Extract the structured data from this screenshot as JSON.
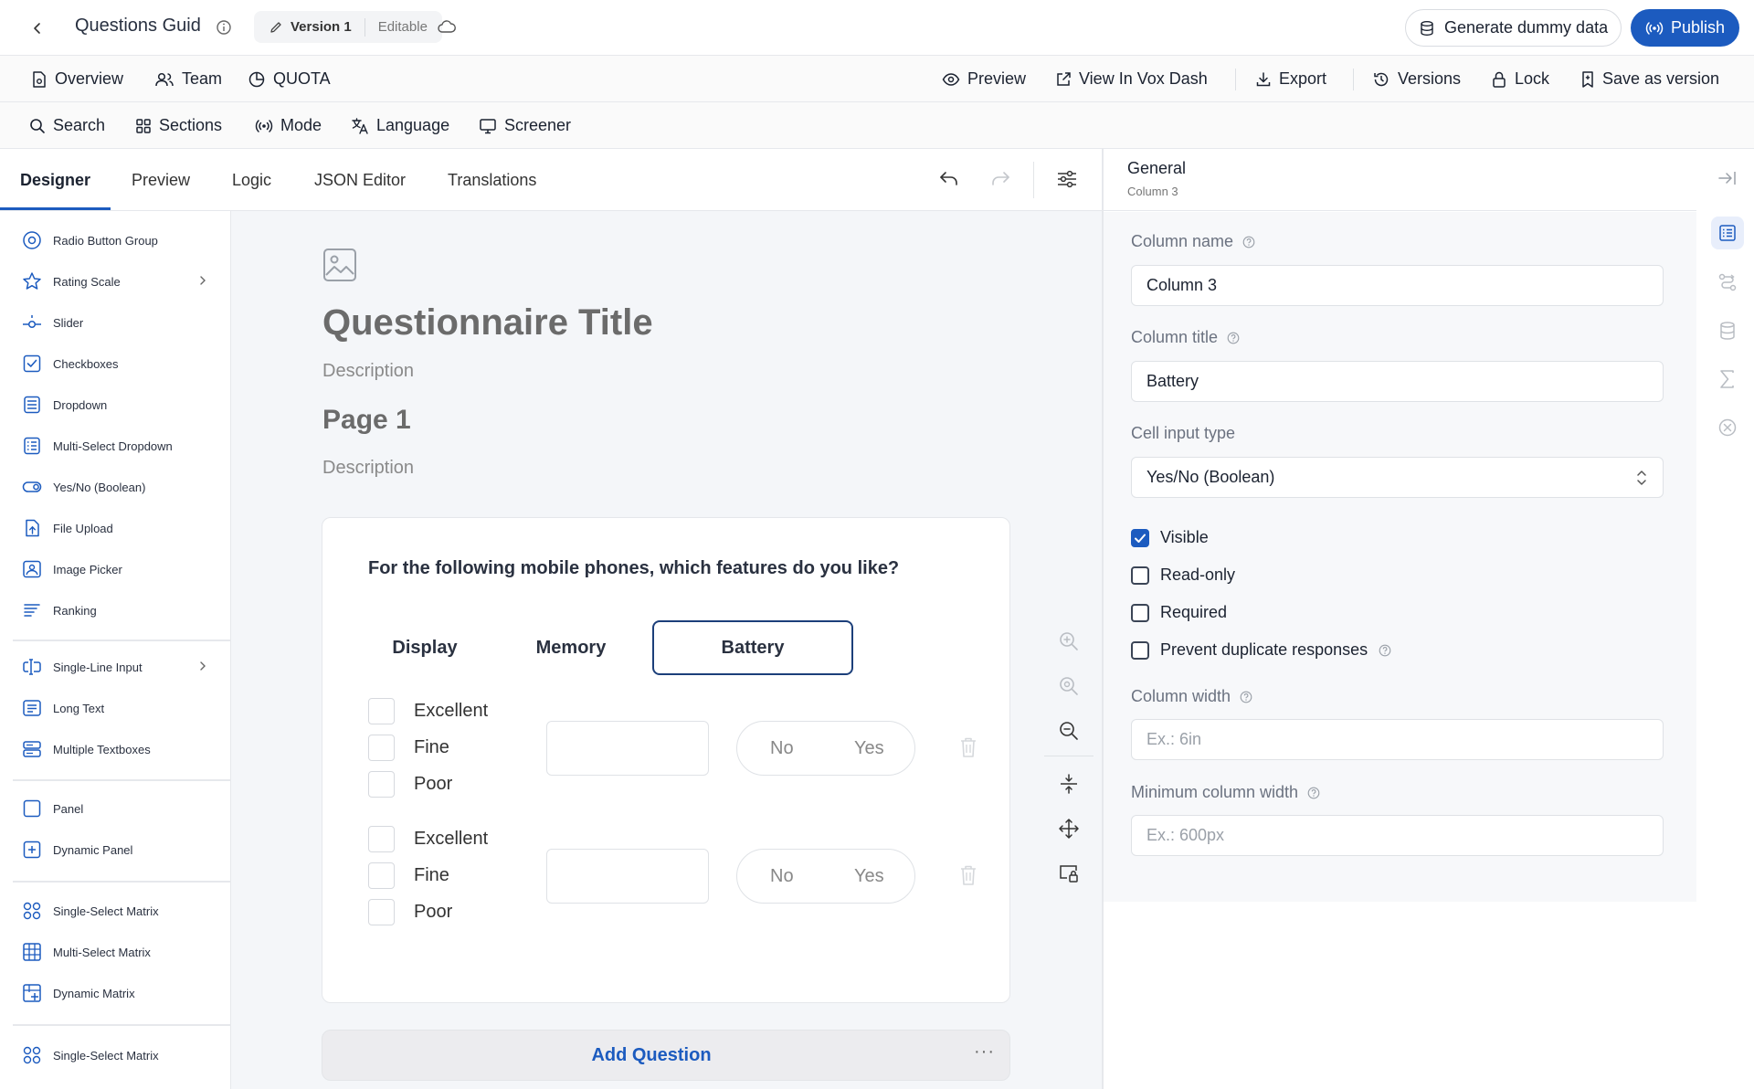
{
  "header": {
    "title": "Questions Guid",
    "version_label": "Version 1",
    "version_state": "Editable",
    "generate_label": "Generate dummy data",
    "publish_label": "Publish"
  },
  "nav1": {
    "overview": "Overview",
    "team": "Team",
    "quota": "QUOTA",
    "preview": "Preview",
    "view_vox": "View In Vox Dash",
    "export": "Export",
    "versions": "Versions",
    "lock": "Lock",
    "save_version": "Save as version"
  },
  "nav2": {
    "search": "Search",
    "sections": "Sections",
    "mode": "Mode",
    "language": "Language",
    "screener": "Screener"
  },
  "tabs": [
    "Designer",
    "Preview",
    "Logic",
    "JSON Editor",
    "Translations"
  ],
  "toolbox": {
    "items": [
      "Radio Button Group",
      "Rating Scale",
      "Slider",
      "Checkboxes",
      "Dropdown",
      "Multi-Select Dropdown",
      "Yes/No (Boolean)",
      "File Upload",
      "Image Picker",
      "Ranking",
      "Single-Line Input",
      "Long Text",
      "Multiple Textboxes",
      "Panel",
      "Dynamic Panel",
      "Single-Select Matrix",
      "Multi-Select Matrix",
      "Dynamic Matrix",
      "Single-Select Matrix"
    ]
  },
  "survey": {
    "title": "Questionnaire Title",
    "description": "Description",
    "page_title": "Page 1",
    "page_description": "Description",
    "question": "For the following mobile phones, which features do you like?",
    "columns": [
      "Display",
      "Memory",
      "Battery"
    ],
    "options": [
      "Excellent",
      "Fine",
      "Poor"
    ],
    "bool_no": "No",
    "bool_yes": "Yes",
    "add_question": "Add Question",
    "more": "···"
  },
  "props": {
    "section_title": "General",
    "section_subtitle": "Column 3",
    "column_name_label": "Column name",
    "column_name_value": "Column 3",
    "column_title_label": "Column title",
    "column_title_value": "Battery",
    "cell_input_label": "Cell input type",
    "cell_input_value": "Yes/No (Boolean)",
    "visible_label": "Visible",
    "readonly_label": "Read-only",
    "required_label": "Required",
    "prevent_dup_label": "Prevent duplicate responses",
    "column_width_label": "Column width",
    "column_width_placeholder": "Ex.: 6in",
    "min_width_label": "Minimum column width",
    "min_width_placeholder": "Ex.: 600px"
  },
  "colors": {
    "accent": "#1c5bbf",
    "selected_border": "#1c3f7a",
    "canvas_bg": "#f4f6f9"
  }
}
